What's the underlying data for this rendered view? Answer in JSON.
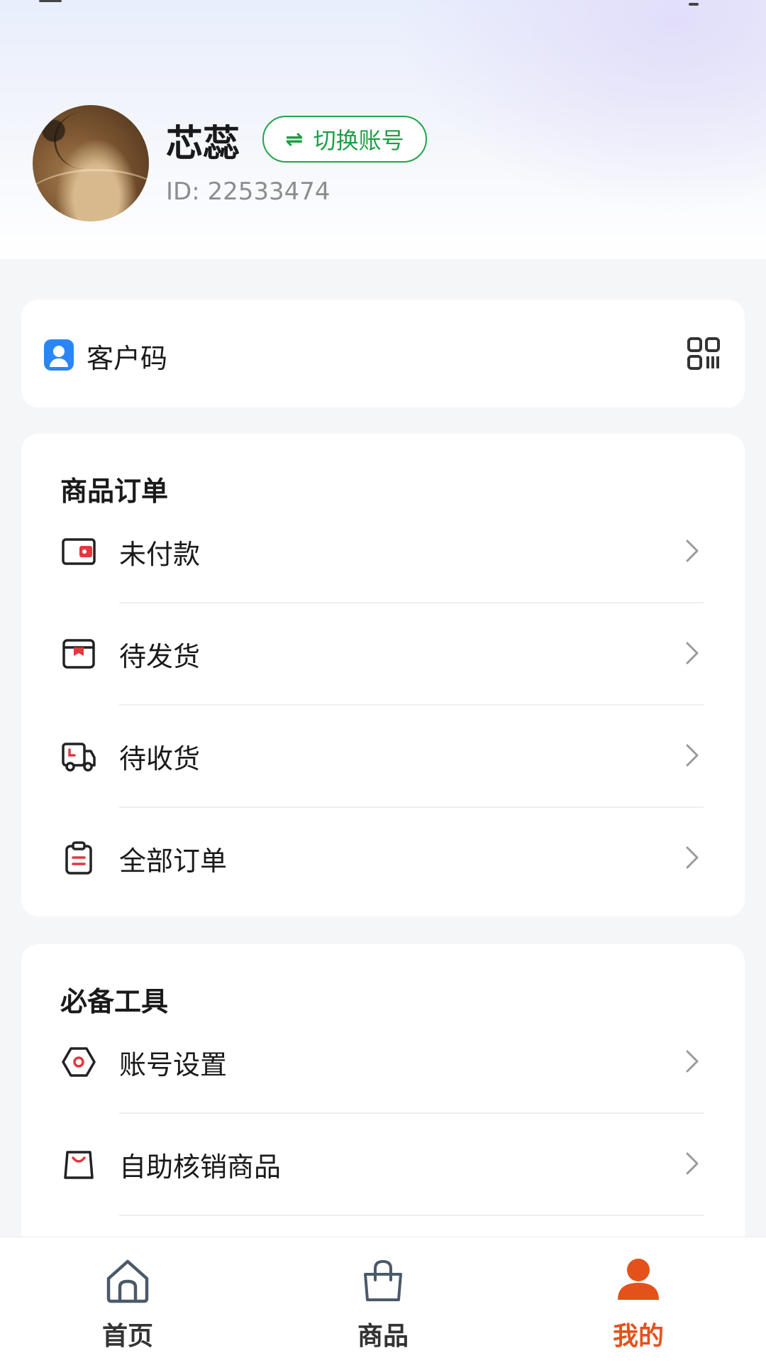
{
  "profile": {
    "name": "芯蕊",
    "switch_label": "切换账号",
    "id_text": "ID: 22533474"
  },
  "customer_code": {
    "label": "客户码",
    "icon": "user-badge-icon",
    "action_icon": "qr-code-icon"
  },
  "orders": {
    "title": "商品订单",
    "items": [
      {
        "label": "未付款",
        "icon": "wallet-icon"
      },
      {
        "label": "待发货",
        "icon": "package-icon"
      },
      {
        "label": "待收货",
        "icon": "truck-icon"
      },
      {
        "label": "全部订单",
        "icon": "clipboard-icon"
      }
    ]
  },
  "tools": {
    "title": "必备工具",
    "items": [
      {
        "label": "账号设置",
        "icon": "settings-hexagon-icon"
      },
      {
        "label": "自助核销商品",
        "icon": "bag-icon"
      }
    ]
  },
  "nav": {
    "items": [
      {
        "label": "首页",
        "icon": "home-icon",
        "active": false
      },
      {
        "label": "商品",
        "icon": "shopping-bag-icon",
        "active": false
      },
      {
        "label": "我的",
        "icon": "person-icon",
        "active": true
      }
    ]
  },
  "colors": {
    "accent_green": "#1e9e45",
    "accent_orange": "#e4521c",
    "accent_blue": "#2a86f4",
    "accent_red": "#e0393e"
  }
}
